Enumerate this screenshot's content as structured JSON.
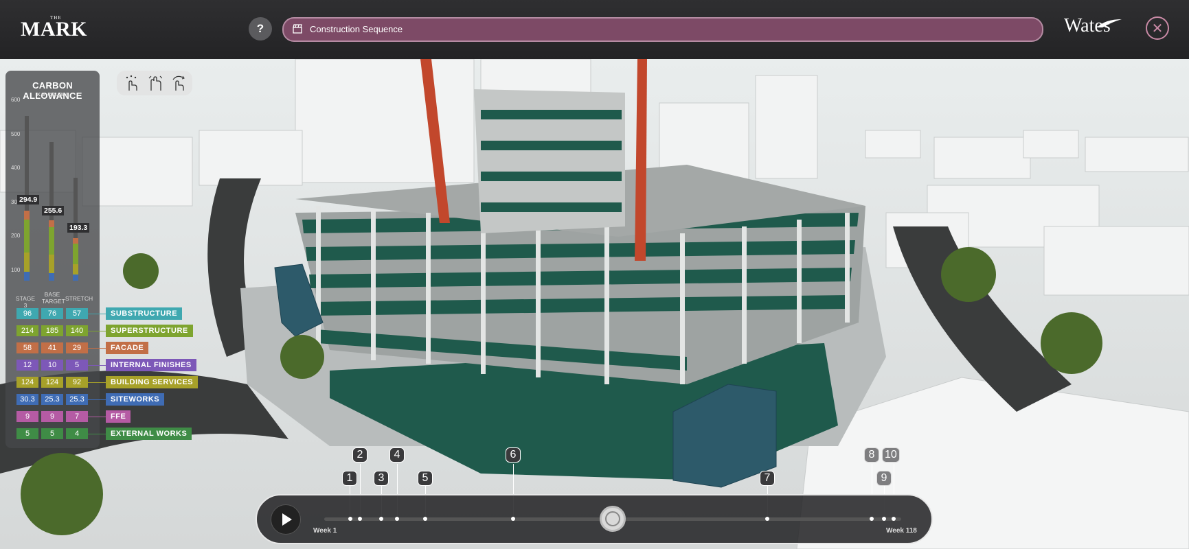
{
  "header": {
    "logo_small": "THE",
    "logo_main": "MARK",
    "help_label": "?",
    "sequence_label": "Construction Sequence",
    "brand": "Wates"
  },
  "carbon_panel": {
    "title": "CARBON ALLOWANCE",
    "unit": "KG CO₂/M²",
    "y_ticks": [
      "600",
      "500",
      "400",
      "300",
      "200",
      "100"
    ],
    "columns": [
      {
        "label": "STAGE 3",
        "total": "294.9"
      },
      {
        "label": "BASE TARGET",
        "total": "255.6"
      },
      {
        "label": "STRETCH",
        "total": "193.3"
      }
    ],
    "rows": [
      {
        "values": [
          "96",
          "76",
          "57"
        ],
        "category": "SUBSTRUCTURE",
        "color": "#3fa8b0"
      },
      {
        "values": [
          "214",
          "185",
          "140"
        ],
        "category": "SUPERSTRUCTURE",
        "color": "#7ea42f"
      },
      {
        "values": [
          "58",
          "41",
          "29"
        ],
        "category": "FACADE",
        "color": "#c26f47"
      },
      {
        "values": [
          "12",
          "10",
          "5"
        ],
        "category": "INTERNAL FINISHES",
        "color": "#7d58b8"
      },
      {
        "values": [
          "124",
          "124",
          "92"
        ],
        "category": "BUILDING SERVICES",
        "color": "#a7a129"
      },
      {
        "values": [
          "30.3",
          "25.3",
          "25.3"
        ],
        "category": "SITEWORKS",
        "color": "#3f6cb4"
      },
      {
        "values": [
          "9",
          "9",
          "7"
        ],
        "category": "FFE",
        "color": "#b55ba4"
      },
      {
        "values": [
          "5",
          "5",
          "4"
        ],
        "category": "EXTERNAL WORKS",
        "color": "#3f8c46"
      }
    ]
  },
  "tools": [
    "select-gesture-icon",
    "pan-gesture-icon",
    "rotate-gesture-icon"
  ],
  "timeline": {
    "start_label": "Week 1",
    "end_label": "Week 118",
    "milestones": [
      "1",
      "2",
      "3",
      "4",
      "5",
      "6",
      "7",
      "8",
      "9",
      "10"
    ],
    "playhead_progress": 0.5
  }
}
